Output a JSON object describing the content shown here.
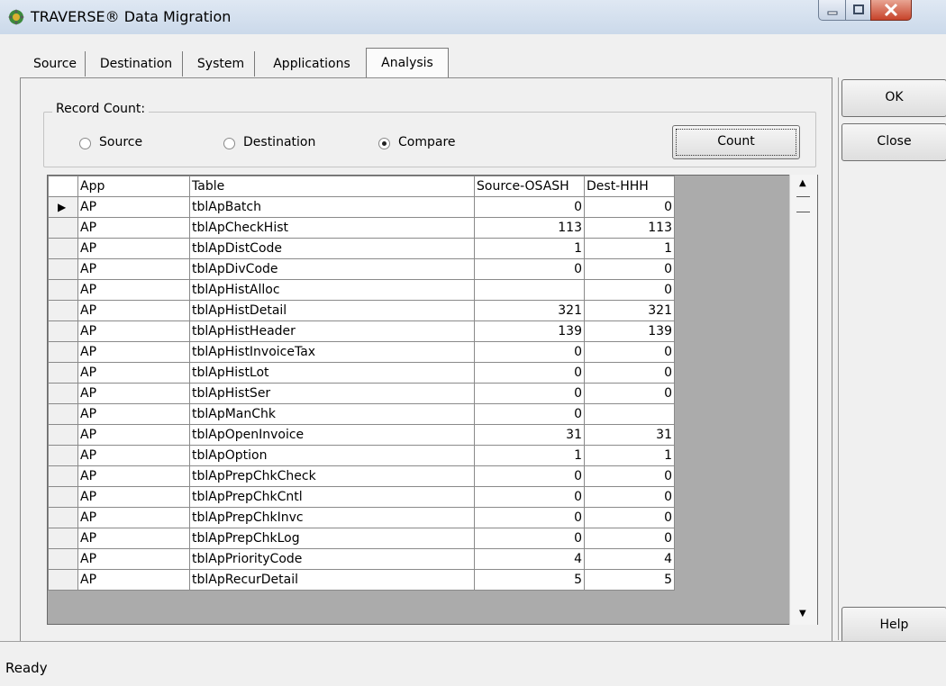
{
  "window": {
    "title": "TRAVERSE® Data Migration",
    "icon": "traverse-app-icon"
  },
  "tabs": [
    {
      "label": "Source",
      "active": false
    },
    {
      "label": "Destination",
      "active": false
    },
    {
      "label": "System",
      "active": false
    },
    {
      "label": "Applications",
      "active": false
    },
    {
      "label": "Analysis",
      "active": true
    }
  ],
  "record_count": {
    "label": "Record Count:",
    "options": [
      {
        "label": "Source",
        "checked": false
      },
      {
        "label": "Destination",
        "checked": false
      },
      {
        "label": "Compare",
        "checked": true
      }
    ],
    "count_button": "Count"
  },
  "side_buttons": {
    "ok": "OK",
    "close": "Close",
    "help": "Help"
  },
  "grid": {
    "columns": [
      "App",
      "Table",
      "Source-OSASH",
      "Dest-HHH"
    ],
    "rows": [
      {
        "app": "AP",
        "table": "tblApBatch",
        "source": "0",
        "dest": "0",
        "current": true
      },
      {
        "app": "AP",
        "table": "tblApCheckHist",
        "source": "113",
        "dest": "113"
      },
      {
        "app": "AP",
        "table": "tblApDistCode",
        "source": "1",
        "dest": "1"
      },
      {
        "app": "AP",
        "table": "tblApDivCode",
        "source": "0",
        "dest": "0"
      },
      {
        "app": "AP",
        "table": "tblApHistAlloc",
        "source": "",
        "dest": "0"
      },
      {
        "app": "AP",
        "table": "tblApHistDetail",
        "source": "321",
        "dest": "321"
      },
      {
        "app": "AP",
        "table": "tblApHistHeader",
        "source": "139",
        "dest": "139"
      },
      {
        "app": "AP",
        "table": "tblApHistInvoiceTax",
        "source": "0",
        "dest": "0"
      },
      {
        "app": "AP",
        "table": "tblApHistLot",
        "source": "0",
        "dest": "0"
      },
      {
        "app": "AP",
        "table": "tblApHistSer",
        "source": "0",
        "dest": "0"
      },
      {
        "app": "AP",
        "table": "tblApManChk",
        "source": "0",
        "dest": ""
      },
      {
        "app": "AP",
        "table": "tblApOpenInvoice",
        "source": "31",
        "dest": "31"
      },
      {
        "app": "AP",
        "table": "tblApOption",
        "source": "1",
        "dest": "1"
      },
      {
        "app": "AP",
        "table": "tblApPrepChkCheck",
        "source": "0",
        "dest": "0"
      },
      {
        "app": "AP",
        "table": "tblApPrepChkCntl",
        "source": "0",
        "dest": "0"
      },
      {
        "app": "AP",
        "table": "tblApPrepChkInvc",
        "source": "0",
        "dest": "0"
      },
      {
        "app": "AP",
        "table": "tblApPrepChkLog",
        "source": "0",
        "dest": "0"
      },
      {
        "app": "AP",
        "table": "tblApPriorityCode",
        "source": "4",
        "dest": "4"
      },
      {
        "app": "AP",
        "table": "tblApRecurDetail",
        "source": "5",
        "dest": "5"
      }
    ]
  },
  "status": {
    "text": "Ready"
  }
}
